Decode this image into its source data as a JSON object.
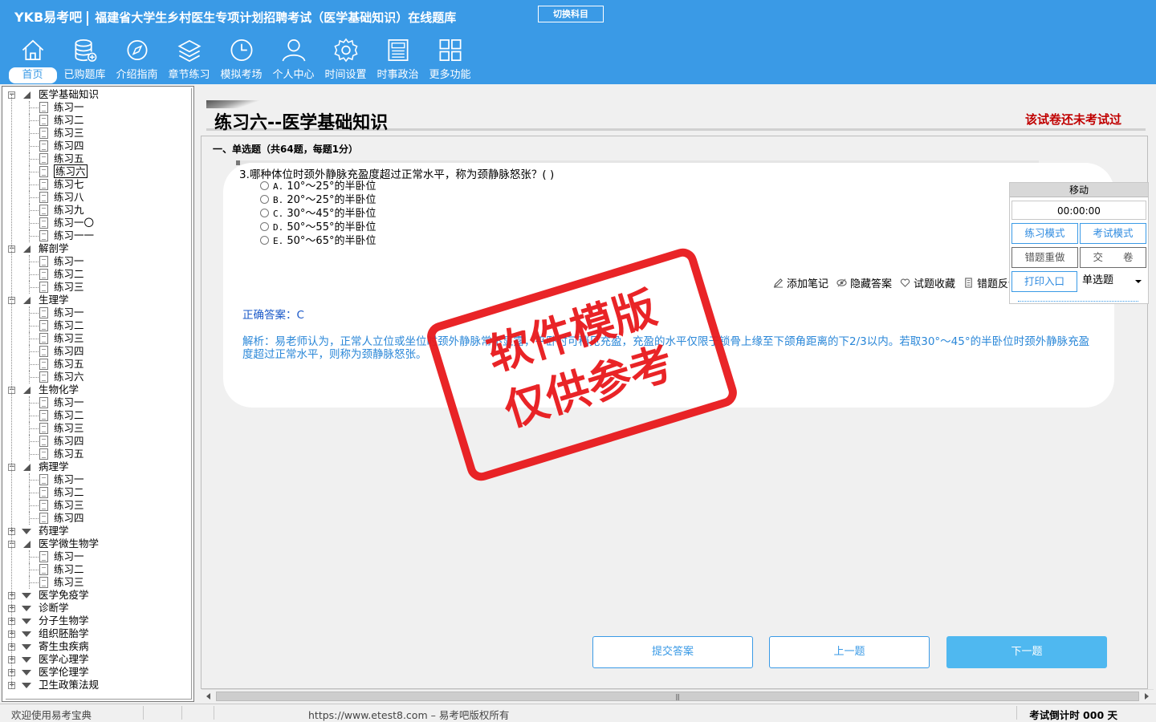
{
  "header": {
    "brand": "YKB易考吧",
    "title": "福建省大学生乡村医生专项计划招聘考试（医学基础知识）在线题库",
    "switch_label": "切换科目",
    "nav": [
      {
        "label": "首页",
        "icon": "home-icon"
      },
      {
        "label": "已购题库",
        "icon": "database-icon"
      },
      {
        "label": "介绍指南",
        "icon": "compass-icon"
      },
      {
        "label": "章节练习",
        "icon": "layers-icon"
      },
      {
        "label": "模拟考场",
        "icon": "clock-icon"
      },
      {
        "label": "个人中心",
        "icon": "user-icon"
      },
      {
        "label": "时间设置",
        "icon": "gear-icon"
      },
      {
        "label": "时事政治",
        "icon": "newspaper-icon"
      },
      {
        "label": "更多功能",
        "icon": "grid-icon"
      }
    ]
  },
  "tree": {
    "categories": [
      {
        "label": "医学基础知识",
        "open": true,
        "items": [
          "练习一",
          "练习二",
          "练习三",
          "练习四",
          "练习五",
          "练习六",
          "练习七",
          "练习八",
          "练习九",
          "练习一〇",
          "练习一一"
        ],
        "selected": 5
      },
      {
        "label": "解剖学",
        "open": true,
        "items": [
          "练习一",
          "练习二",
          "练习三"
        ]
      },
      {
        "label": "生理学",
        "open": true,
        "items": [
          "练习一",
          "练习二",
          "练习三",
          "练习四",
          "练习五",
          "练习六"
        ]
      },
      {
        "label": "生物化学",
        "open": true,
        "items": [
          "练习一",
          "练习二",
          "练习三",
          "练习四",
          "练习五"
        ]
      },
      {
        "label": "病理学",
        "open": true,
        "items": [
          "练习一",
          "练习二",
          "练习三",
          "练习四"
        ]
      },
      {
        "label": "药理学",
        "open": false,
        "items": []
      },
      {
        "label": "医学微生物学",
        "open": true,
        "items": [
          "练习一",
          "练习二",
          "练习三"
        ]
      },
      {
        "label": "医学免疫学",
        "open": false,
        "items": []
      },
      {
        "label": "诊断学",
        "open": false,
        "items": []
      },
      {
        "label": "分子生物学",
        "open": false,
        "items": []
      },
      {
        "label": "组织胚胎学",
        "open": false,
        "items": []
      },
      {
        "label": "寄生虫疾病",
        "open": false,
        "items": []
      },
      {
        "label": "医学心理学",
        "open": false,
        "items": []
      },
      {
        "label": "医学伦理学",
        "open": false,
        "items": []
      },
      {
        "label": "卫生政策法规",
        "open": false,
        "items": []
      }
    ]
  },
  "main": {
    "exam_title": "练习六--医学基础知识",
    "status": "该试卷还未考试过",
    "section_heading": "一、单选题（共64题，每题1分）",
    "question": "3.哪种体位时颈外静脉充盈度超过正常水平，称为颈静脉怒张？( )",
    "options": [
      {
        "key": "A.",
        "text": "10°～25°的半卧位"
      },
      {
        "key": "B.",
        "text": "20°～25°的半卧位"
      },
      {
        "key": "C.",
        "text": "30°～45°的半卧位"
      },
      {
        "key": "D.",
        "text": "50°～55°的半卧位"
      },
      {
        "key": "E.",
        "text": "50°～65°的半卧位"
      }
    ],
    "actions": [
      {
        "label": "添加笔记",
        "icon": "pencil-icon"
      },
      {
        "label": "隐藏答案",
        "icon": "eye-icon"
      },
      {
        "label": "试题收藏",
        "icon": "heart-icon"
      },
      {
        "label": "错题反馈",
        "icon": "feedback-icon"
      }
    ],
    "answer": "正确答案：C",
    "analysis": "解析：易老师认为，正常人立位或坐位时颈外静脉常不显露，平卧时可稍见充盈，充盈的水平仅限于锁骨上缘至下颌角距离的下2/3以内。若取30°～45°的半卧位时颈外静脉充盈度超过正常水平，则称为颈静脉怒张。",
    "watermark": [
      "软件模版",
      "仅供参考"
    ],
    "buttons": {
      "submit": "提交答案",
      "prev": "上一题",
      "next": "下一题"
    }
  },
  "control_panel": {
    "move": "移动",
    "timer": "00:00:00",
    "practice_mode": "练习模式",
    "exam_mode": "考试模式",
    "redo_wrong": "错题重做",
    "hand_in": "交　　卷",
    "print": "打印入口",
    "type_select": "单选题"
  },
  "statusbar": {
    "welcome": "欢迎使用易考宝典",
    "copyright": "https://www.etest8.com – 易考吧版权所有",
    "countdown": "考试倒计时 000 天"
  },
  "colors": {
    "header_bg": "#3a9ae6",
    "status_red": "#c00000",
    "answer_blue": "#1a58c8",
    "stamp_red": "#e8191c"
  }
}
